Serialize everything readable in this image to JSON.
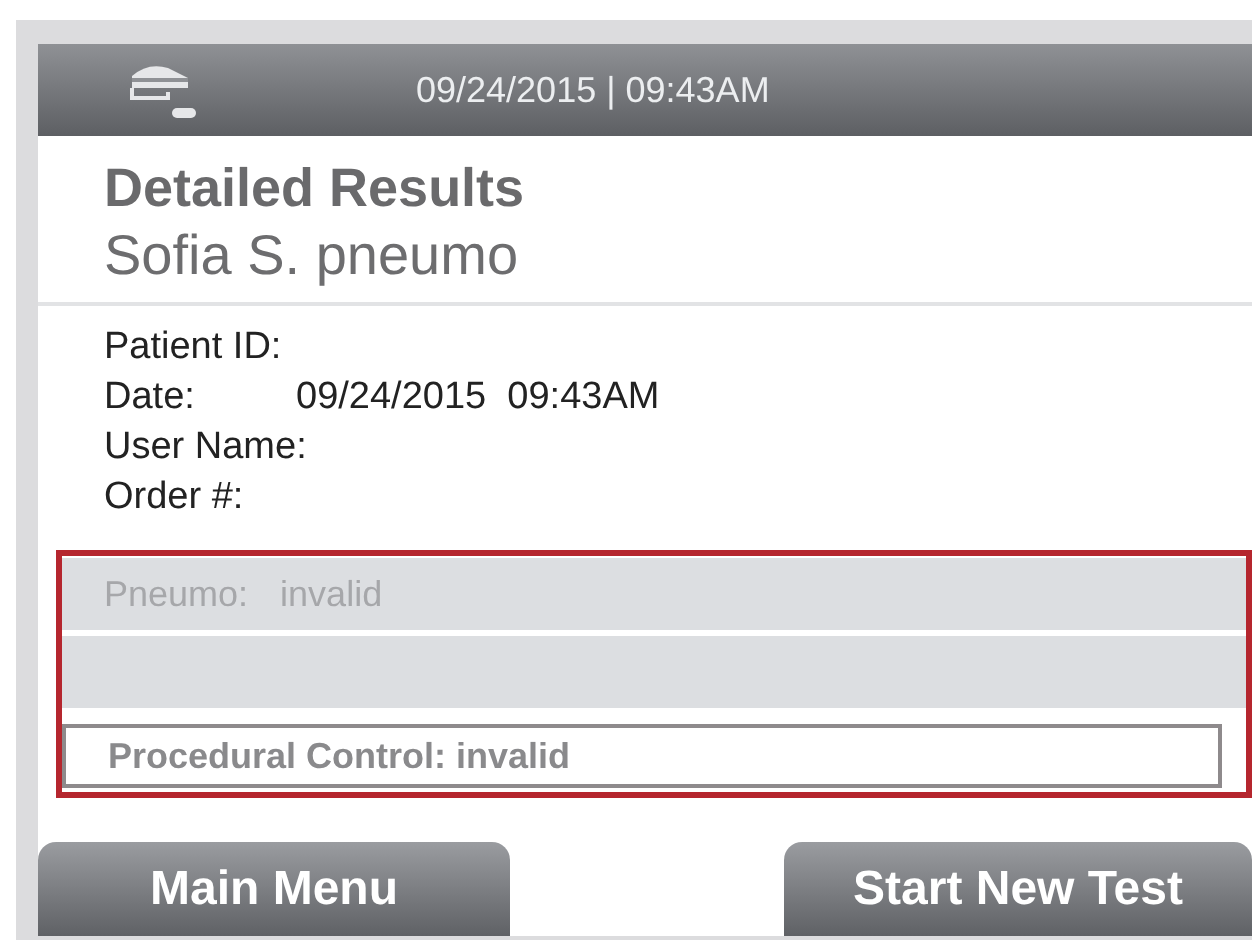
{
  "header": {
    "datetime": "09/24/2015 | 09:43AM"
  },
  "title": "Detailed Results",
  "patient_name": "Sofia S. pneumo",
  "fields": [
    {
      "label": "Patient ID:"
    },
    {
      "label": "Date:",
      "value": "09/24/2015  09:43AM"
    },
    {
      "label": "User Name:"
    },
    {
      "label": "Order #:"
    }
  ],
  "results": {
    "highlighted": true,
    "rows": [
      {
        "kind": "analyte",
        "label": "Pneumo:",
        "value": "invalid",
        "disabled": true
      },
      {
        "kind": "blank"
      },
      {
        "kind": "control",
        "text": "Procedural Control: invalid"
      }
    ]
  },
  "buttons": [
    {
      "label": "Main Menu"
    },
    {
      "label": "Start New Test"
    }
  ]
}
